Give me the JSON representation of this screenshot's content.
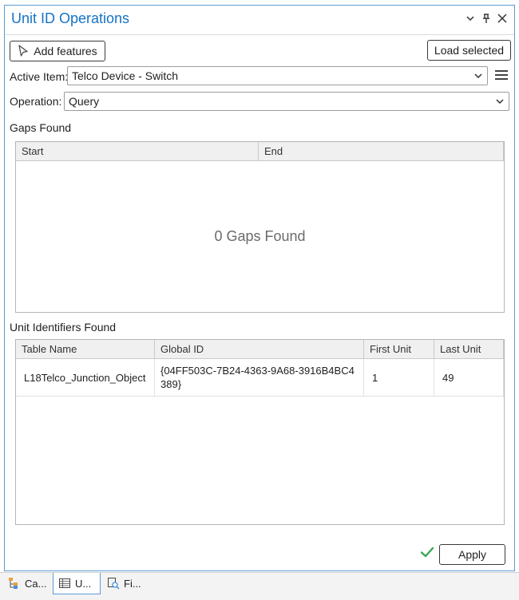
{
  "pane": {
    "title": "Unit ID Operations"
  },
  "toolbar": {
    "add_features_label": "Add features",
    "load_selected_label": "Load selected"
  },
  "active_item": {
    "label": "Active Item:",
    "value": "Telco Device - Switch"
  },
  "operation": {
    "label": "Operation:",
    "value": "Query"
  },
  "gaps": {
    "section_label": "Gaps Found",
    "columns": [
      "Start",
      "End"
    ],
    "rows": [],
    "empty_message": "0 Gaps Found"
  },
  "units": {
    "section_label": "Unit Identifiers Found",
    "columns": [
      "Table Name",
      "Global ID",
      "First Unit",
      "Last Unit"
    ],
    "rows": [
      {
        "table_name": "L18Telco_Junction_Object",
        "global_id": "{04FF503C-7B24-4363-9A68-3916B4BC4389}",
        "first_unit": "1",
        "last_unit": "49"
      }
    ]
  },
  "footer": {
    "apply_label": "Apply",
    "status_icon": "check-icon",
    "status_color": "#3aa655"
  },
  "tabs": [
    {
      "label": "Ca...",
      "icon": "catalog-icon"
    },
    {
      "label": "U...",
      "icon": "table-icon",
      "active": true
    },
    {
      "label": "Fi...",
      "icon": "find-icon"
    }
  ],
  "colors": {
    "title": "#1673c6",
    "pane_border": "#5a9bd5"
  }
}
